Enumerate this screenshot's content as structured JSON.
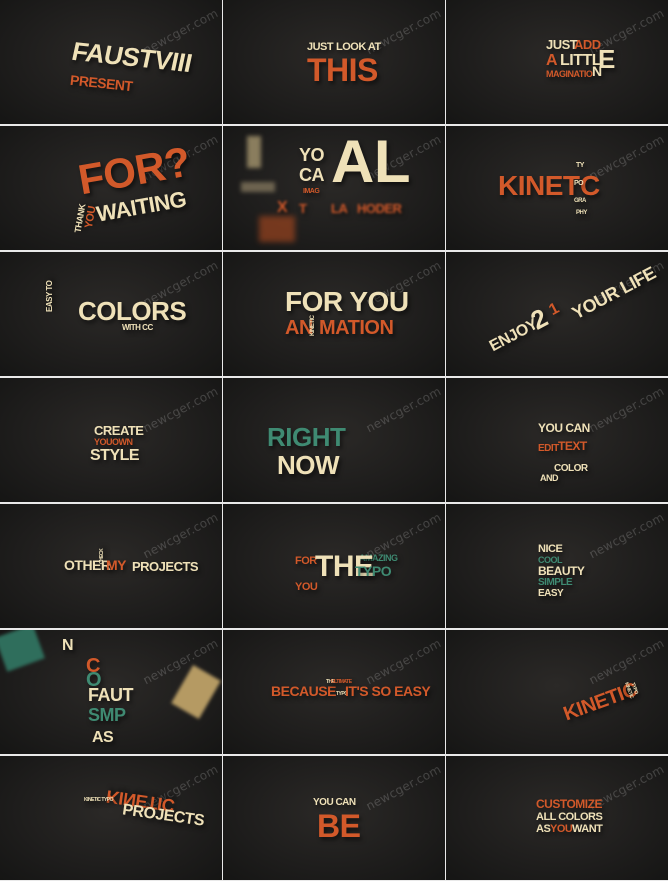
{
  "watermark": "newcger.com",
  "tiles": [
    {
      "id": "t1",
      "lines": [
        "FAUSTVIII",
        "PRESENT"
      ]
    },
    {
      "id": "t2",
      "lines": [
        "JUST",
        "LOOK AT",
        "THIS"
      ]
    },
    {
      "id": "t3",
      "lines": [
        "JUST",
        "ADD",
        "A",
        "LITTL",
        "E",
        "MAGINATIO",
        "N"
      ]
    },
    {
      "id": "t4",
      "lines": [
        "FOR?",
        "THANK",
        "YOU",
        "WAITING"
      ]
    },
    {
      "id": "t5",
      "lines": [
        "YO",
        "CA",
        "IMAG",
        "AL",
        "X",
        "T",
        "LA",
        "HODER"
      ]
    },
    {
      "id": "t6",
      "lines": [
        "KINET",
        "C",
        "TY",
        "PO",
        "GRA",
        "PHY"
      ]
    },
    {
      "id": "t7",
      "lines": [
        "EASY TO",
        "COLORS",
        "WITH CC"
      ]
    },
    {
      "id": "t8",
      "lines": [
        "FOR YOU",
        "AN",
        "KINETIC",
        "MATION"
      ]
    },
    {
      "id": "t9",
      "lines": [
        "ENJOY",
        "2",
        "1",
        "YOUR LIFE"
      ]
    },
    {
      "id": "t10",
      "lines": [
        "CREATE",
        "YOUOWN",
        "STYLE"
      ]
    },
    {
      "id": "t11",
      "lines": [
        "RIGHT",
        "NOW"
      ]
    },
    {
      "id": "t12",
      "lines": [
        "YOU CAN",
        "EDIT",
        "TEXT",
        "COLOR",
        "AND"
      ]
    },
    {
      "id": "t13",
      "lines": [
        "OTHER",
        "CHECK",
        "MY",
        "PROJECTS"
      ]
    },
    {
      "id": "t14",
      "lines": [
        "FOR",
        "AMAZING",
        "THE",
        "TYPO",
        "YOU"
      ]
    },
    {
      "id": "t15",
      "lines": [
        "NICE",
        "COOL",
        "BEAUTY",
        "SIMPLE",
        "EASY"
      ]
    },
    {
      "id": "t16",
      "lines": [
        "N",
        "C",
        "O",
        "FAUT",
        "SMP",
        "AS"
      ]
    },
    {
      "id": "t17",
      "lines": [
        "BECAUSE",
        "THE",
        "ULTIMATE",
        "TYPO",
        "IT'S SO EASY"
      ]
    },
    {
      "id": "t18",
      "lines": [
        "KINETIC",
        "KINETIC",
        "TYPO"
      ]
    },
    {
      "id": "t19",
      "lines": [
        "KINETIC",
        "KINETIC TYPO",
        "PROJECTS"
      ]
    },
    {
      "id": "t20",
      "lines": [
        "YOU CAN",
        "BE"
      ]
    },
    {
      "id": "t21",
      "lines": [
        "CUSTOMIZE",
        "ALL COLORS",
        "AS",
        "YOU",
        "WANT"
      ]
    }
  ],
  "colors": {
    "cream": "#efe1b8",
    "orange": "#d2592a",
    "green": "#3f8a72",
    "background": "#1e1d1c"
  }
}
